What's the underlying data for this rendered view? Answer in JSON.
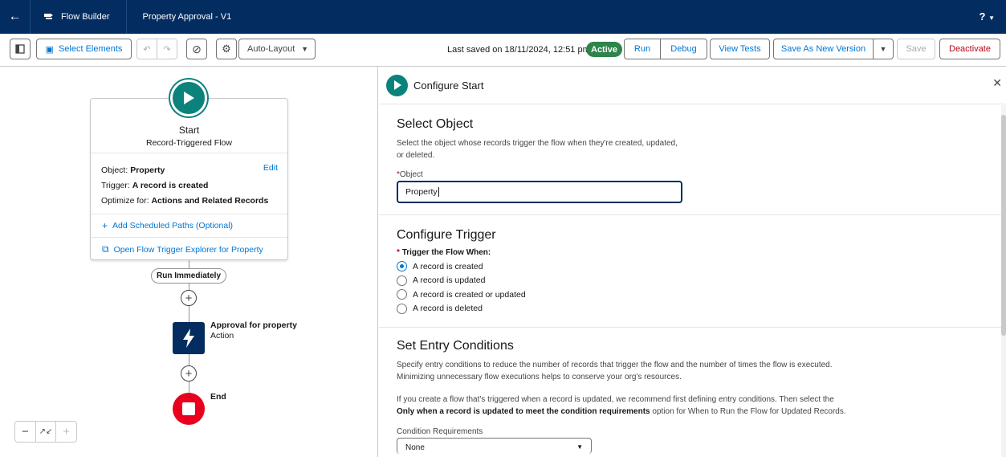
{
  "header": {
    "app_name": "Flow Builder",
    "flow_title": "Property Approval - V1",
    "help": "?"
  },
  "toolbar": {
    "select_elements": "Select Elements",
    "layout_mode": "Auto-Layout",
    "last_saved": "Last saved on 18/11/2024, 12:51 pm",
    "status": "Active",
    "run": "Run",
    "debug": "Debug",
    "view_tests": "View Tests",
    "save_as_new_version": "Save As New Version",
    "save": "Save",
    "deactivate": "Deactivate"
  },
  "canvas": {
    "start": {
      "title": "Start",
      "subtitle": "Record-Triggered Flow",
      "edit": "Edit",
      "object_label": "Object:",
      "object_value": "Property",
      "trigger_label": "Trigger:",
      "trigger_value": "A record is created",
      "optimize_label": "Optimize for:",
      "optimize_value": "Actions and Related Records",
      "add_scheduled": "Add Scheduled Paths (Optional)",
      "open_explorer": "Open Flow Trigger Explorer for Property"
    },
    "path_label": "Run Immediately",
    "action": {
      "name": "Approval for property",
      "type": "Action"
    },
    "end": "End"
  },
  "panel": {
    "title": "Configure Start",
    "select_object": {
      "heading": "Select Object",
      "desc": "Select the object whose records trigger the flow when they're created, updated, or deleted.",
      "field_label": "Object",
      "field_value": "Property"
    },
    "configure_trigger": {
      "heading": "Configure Trigger",
      "label": "Trigger the Flow When:",
      "options": [
        "A record is created",
        "A record is updated",
        "A record is created or updated",
        "A record is deleted"
      ],
      "selected_index": 0
    },
    "entry_conditions": {
      "heading": "Set Entry Conditions",
      "desc1": "Specify entry conditions to reduce the number of records that trigger the flow and the number of times the flow is executed. Minimizing unnecessary flow executions helps to conserve your org's resources.",
      "desc2_pre": "If you create a flow that's triggered when a record is updated, we recommend first defining entry conditions. Then select the ",
      "desc2_bold": "Only when a record is updated to meet the condition requirements",
      "desc2_post": " option for When to Run the Flow for Updated Records.",
      "condition_label": "Condition Requirements",
      "condition_value": "None"
    }
  },
  "colors": {
    "nav": "#032d60",
    "start_teal": "#0b827c",
    "active_green": "#2e844a",
    "end_red": "#ea001e",
    "link_blue": "#0176d3"
  }
}
